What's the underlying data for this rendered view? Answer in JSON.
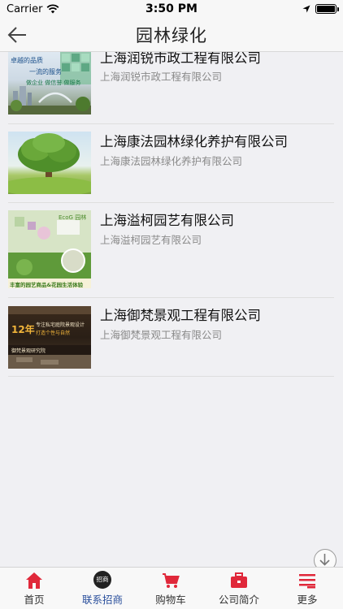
{
  "status_bar": {
    "carrier": "Carrier",
    "time": "3:50 PM"
  },
  "nav": {
    "title": "园林绿化"
  },
  "companies": [
    {
      "title": "上海润锐市政工程有限公司",
      "subtitle": "上海润锐市政工程有限公司",
      "thumb": {
        "line1": "卓越的品质",
        "line2": "一流的服务",
        "line3": "做企业 做信誉 做服务"
      }
    },
    {
      "title": "上海康法园林绿化养护有限公司",
      "subtitle": "上海康法园林绿化养护有限公司"
    },
    {
      "title": "上海溢柯园艺有限公司",
      "subtitle": "上海溢柯园艺有限公司",
      "thumb": {
        "brand": "EcoG 园林",
        "caption": "丰富的园艺商品&花园生活体验"
      }
    },
    {
      "title": "上海御梵景观工程有限公司",
      "subtitle": "上海御梵景观工程有限公司",
      "thumb": {
        "years": "12年",
        "line1": "专注私宅庭院景观设计",
        "line2": "御梵景观研究院",
        "line3": "打造个性与自然"
      }
    }
  ],
  "tabs": [
    {
      "label": "首页",
      "icon": "home-icon"
    },
    {
      "label": "联系招商",
      "icon": "recruit-badge-icon",
      "badge": "招商"
    },
    {
      "label": "购物车",
      "icon": "cart-icon"
    },
    {
      "label": "公司简介",
      "icon": "briefcase-icon"
    },
    {
      "label": "更多",
      "icon": "more-list-icon"
    }
  ],
  "colors": {
    "accent_red": "#e0283a",
    "active_tab": "#2a4f9c",
    "divider": "#dedede"
  }
}
